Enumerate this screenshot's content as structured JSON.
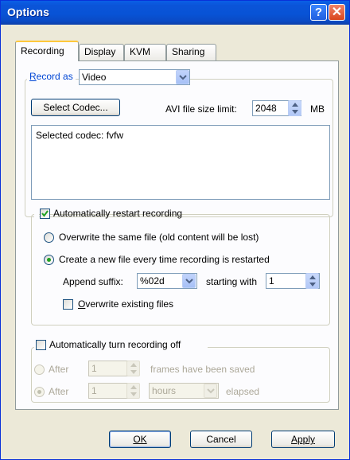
{
  "window": {
    "title": "Options"
  },
  "title_buttons": {
    "help": "?",
    "close": "✕"
  },
  "tabs": [
    {
      "label": "Recording",
      "active": true
    },
    {
      "label": "Display",
      "active": false
    },
    {
      "label": "KVM",
      "active": false
    },
    {
      "label": "Sharing",
      "active": false
    }
  ],
  "record_as": {
    "label": "Record as",
    "value": "Video"
  },
  "codec": {
    "select_button": "Select Codec...",
    "avi_limit_label": "AVI file size limit:",
    "avi_limit_value": "2048",
    "avi_limit_unit": "MB",
    "selected_text": "Selected codec: fvfw"
  },
  "restart": {
    "checkbox_label": "Automatically restart recording",
    "checked": true,
    "overwrite_label": "Overwrite the same file (old content will be lost)",
    "create_new_label": "Create a new file every time recording is restarted",
    "selected_option": "create_new",
    "append_suffix_label": "Append suffix:",
    "append_suffix_value": "%02d",
    "starting_with_label": "starting with",
    "starting_with_value": "1",
    "overwrite_existing_label": "Overwrite existing files",
    "overwrite_existing_checked": false
  },
  "turn_off": {
    "checkbox_label": "Automatically turn recording off",
    "checked": false,
    "after1_label": "After",
    "after1_value": "1",
    "after1_suffix": "frames have been saved",
    "after2_label": "After",
    "after2_value": "1",
    "after2_unit": "hours",
    "after2_suffix": "elapsed",
    "selected_option": "after_time"
  },
  "buttons": {
    "ok": "OK",
    "cancel": "Cancel",
    "apply": "Apply"
  },
  "colors": {
    "title_bar": "#0a54d8",
    "dialog_bg": "#ece9d8",
    "radio_dot": "#21a121",
    "check_mark": "#21a121"
  }
}
